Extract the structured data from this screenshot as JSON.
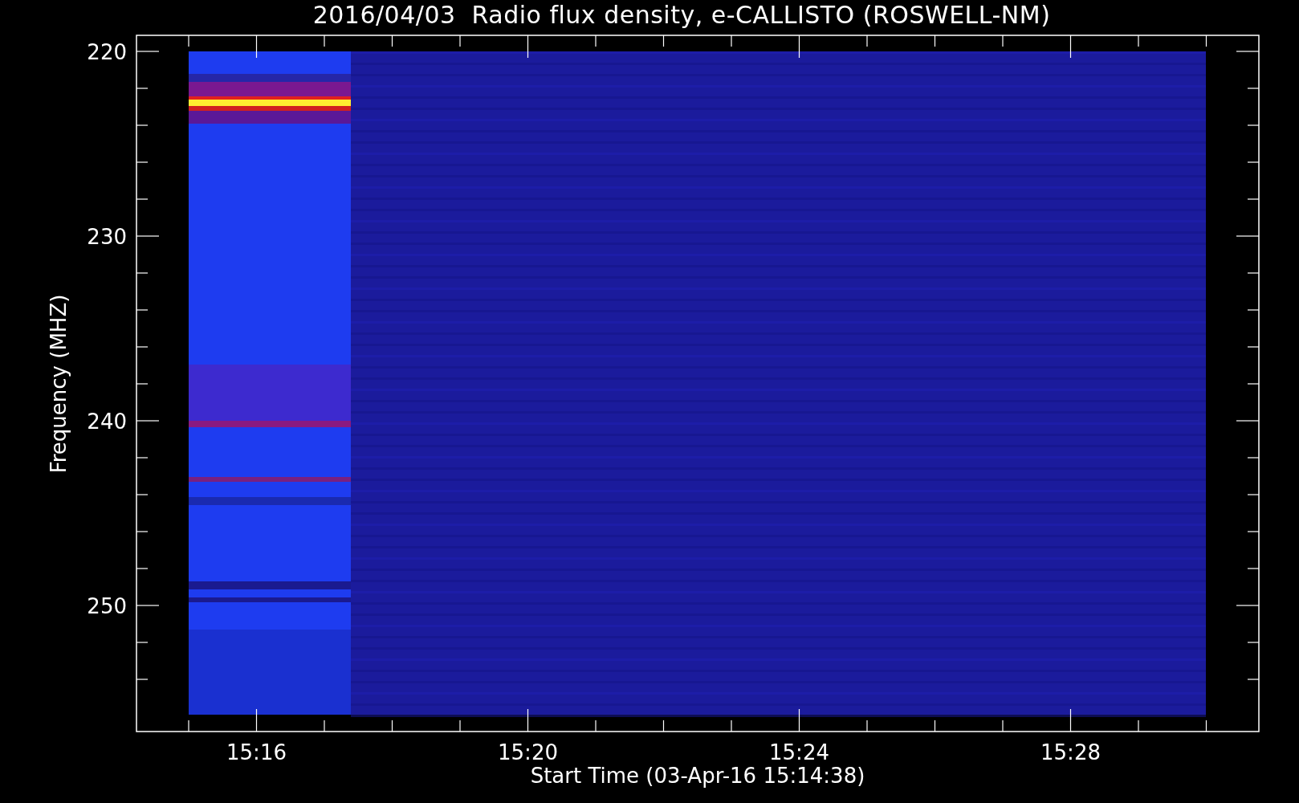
{
  "title": "2016/04/03  Radio flux density, e-CALLISTO (ROSWELL-NM)",
  "ylabel": "Frequency (MHZ)",
  "xlabel": "Start Time (03-Apr-16 15:14:38)",
  "yticks": [
    "220",
    "230",
    "240",
    "250"
  ],
  "xticks": [
    "15:16",
    "15:20",
    "15:24",
    "15:28"
  ]
}
